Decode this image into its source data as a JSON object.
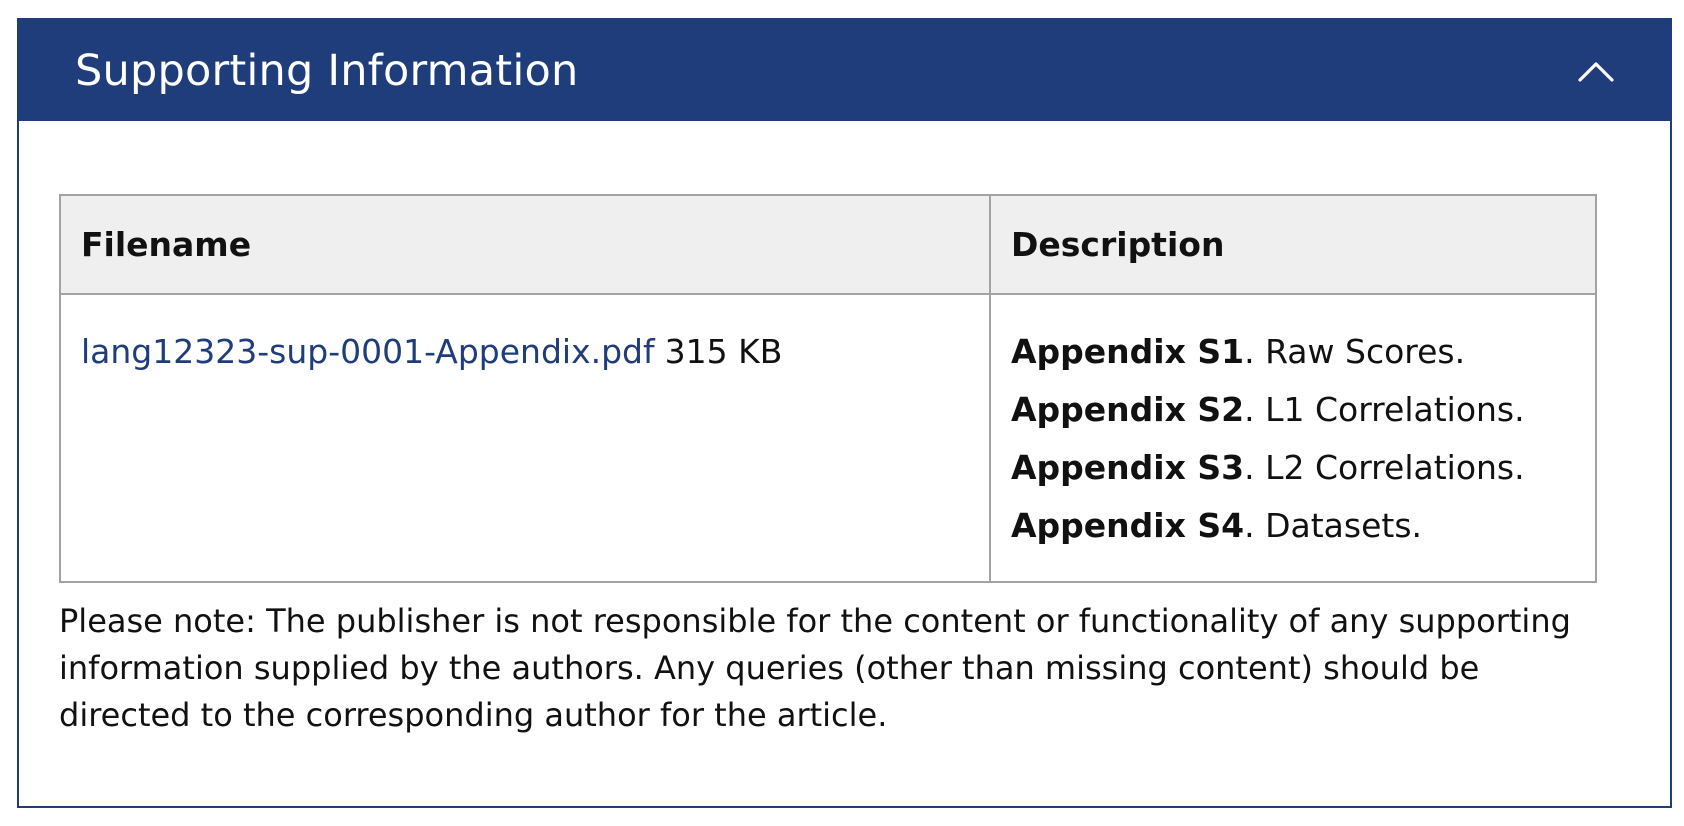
{
  "panel": {
    "title": "Supporting Information",
    "header_bg": "#1f3c7b",
    "collapse_icon": "chevron-up-icon"
  },
  "table": {
    "headers": {
      "filename": "Filename",
      "description": "Description"
    },
    "rows": [
      {
        "filename": "lang12323-sup-0001-Appendix.pdf",
        "size": "315 KB",
        "descriptions": [
          {
            "label": "Appendix S1",
            "text": ". Raw Scores."
          },
          {
            "label": "Appendix S2",
            "text": ". L1 Correlations."
          },
          {
            "label": "Appendix S3",
            "text": ". L2 Correlations."
          },
          {
            "label": "Appendix S4",
            "text": ". Datasets."
          }
        ]
      }
    ]
  },
  "note": "Please note: The publisher is not responsible for the content or functionality of any supporting information supplied by the authors. Any queries (other than missing content) should be directed to the corresponding author for the article.",
  "colors": {
    "link": "#1f3c7b",
    "table_border": "#a3a3a3",
    "header_row_bg": "#efefef"
  }
}
